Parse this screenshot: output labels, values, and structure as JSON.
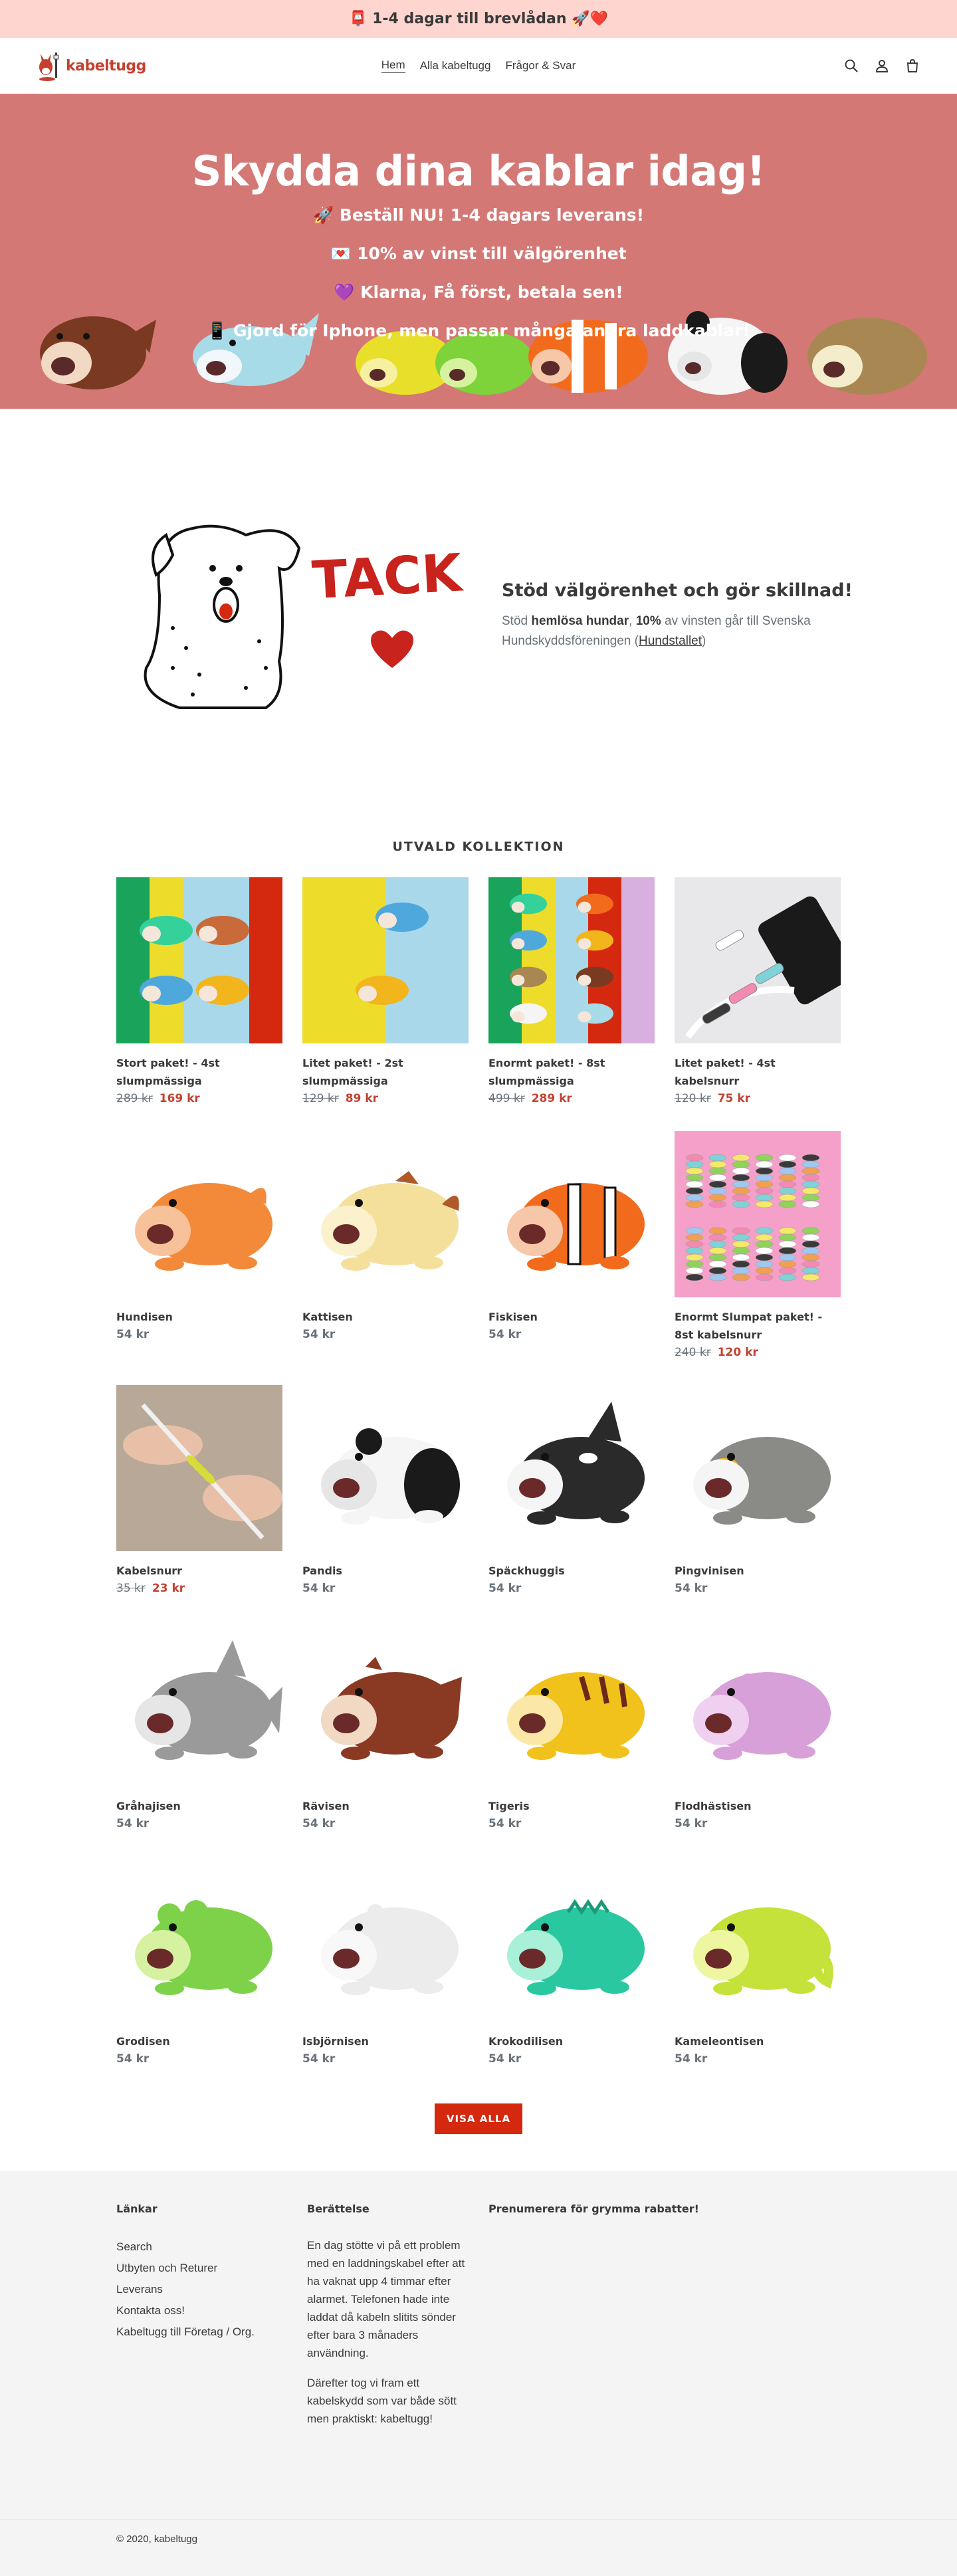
{
  "announcement": {
    "text": "📮 1-4 dagar till brevlådan 🚀❤️"
  },
  "header": {
    "logo_text": "kabeltugg",
    "nav": [
      {
        "label": "Hem",
        "active": true
      },
      {
        "label": "Alla kabeltugg",
        "active": false
      },
      {
        "label": "Frågor & Svar",
        "active": false
      }
    ],
    "icons": [
      "search-icon",
      "account-icon",
      "cart-icon"
    ]
  },
  "hero": {
    "title": "Skydda dina kablar idag!",
    "lines": [
      "🚀 Beställ NU! 1-4 dagars leverans!",
      "💌 10% av vinst till välgörenhet",
      "💜 Klarna, Få först, betala sen!",
      "📱 Gjord för Iphone, men passar många andra laddkablar!"
    ]
  },
  "charity": {
    "tack": "TACK!",
    "heading": "Stöd välgörenhet och gör skillnad!",
    "text_parts": [
      "Stöd ",
      "hemlösa hundar",
      ", ",
      "10%",
      " av vinsten går till Svenska Hundskyddsföreningen (",
      "Hundstallet",
      ")"
    ]
  },
  "collection": {
    "title": "UTVALD KOLLEKTION",
    "products": [
      {
        "name": "Stort paket! - 4st slumpmässiga",
        "old_price": "289 kr",
        "price": "169 kr",
        "image": "pack4"
      },
      {
        "name": "Litet paket! - 2st slumpmässiga",
        "old_price": "129 kr",
        "price": "89 kr",
        "image": "pack2"
      },
      {
        "name": "Enormt paket! - 8st slumpmässiga",
        "old_price": "499 kr",
        "price": "289 kr",
        "image": "pack8"
      },
      {
        "name": "Litet paket! - 4st kabelsnurr",
        "old_price": "120 kr",
        "price": "75 kr",
        "image": "spiral-small"
      },
      {
        "name": "Hundisen",
        "price": "54 kr",
        "image": "dog"
      },
      {
        "name": "Kattisen",
        "price": "54 kr",
        "image": "cat"
      },
      {
        "name": "Fiskisen",
        "price": "54 kr",
        "image": "clownfish"
      },
      {
        "name": "Enormt Slumpat paket! - 8st kabelsnurr",
        "old_price": "240 kr",
        "price": "120 kr",
        "image": "spiral-big"
      },
      {
        "name": "Kabelsnurr",
        "old_price": "35 kr",
        "price": "23 kr",
        "image": "spiral-hand"
      },
      {
        "name": "Pandis",
        "price": "54 kr",
        "image": "panda"
      },
      {
        "name": "Späckhuggis",
        "price": "54 kr",
        "image": "orca"
      },
      {
        "name": "Pingvinisen",
        "price": "54 kr",
        "image": "penguin"
      },
      {
        "name": "Gråhajisen",
        "price": "54 kr",
        "image": "shark"
      },
      {
        "name": "Rävisen",
        "price": "54 kr",
        "image": "redpanda"
      },
      {
        "name": "Tigeris",
        "price": "54 kr",
        "image": "tiger"
      },
      {
        "name": "Flodhästisen",
        "price": "54 kr",
        "image": "hippo"
      },
      {
        "name": "Grodisen",
        "price": "54 kr",
        "image": "frog"
      },
      {
        "name": "Isbjörnisen",
        "price": "54 kr",
        "image": "polarbear"
      },
      {
        "name": "Krokodilisen",
        "price": "54 kr",
        "image": "croc"
      },
      {
        "name": "Kameleontisen",
        "price": "54 kr",
        "image": "chameleon"
      }
    ],
    "view_all": "VISA ALLA"
  },
  "footer": {
    "links_title": "Länkar",
    "links": [
      "Search",
      "Utbyten och Returer",
      "Leverans",
      "Kontakta oss!",
      "Kabeltugg till Företag / Org."
    ],
    "story_title": "Berättelse",
    "story": [
      "En dag stötte vi på ett problem med en laddningskabel efter att ha vaknat upp 4 timmar efter alarmet. Telefonen hade inte laddat då kabeln slitits sönder efter bara 3 månaders användning.",
      "Därefter tog vi fram ett kabelskydd som var både sött men praktiskt: kabeltugg!"
    ],
    "newsletter_title": "Prenumerera för grymma rabatter!",
    "copyright": "© 2020, kabeltugg"
  },
  "colors": {
    "hero_bg": "#d47876",
    "announcement_bg": "#ffd6cf",
    "accent": "#d4280f",
    "footer_bg": "#f4f4f4"
  }
}
